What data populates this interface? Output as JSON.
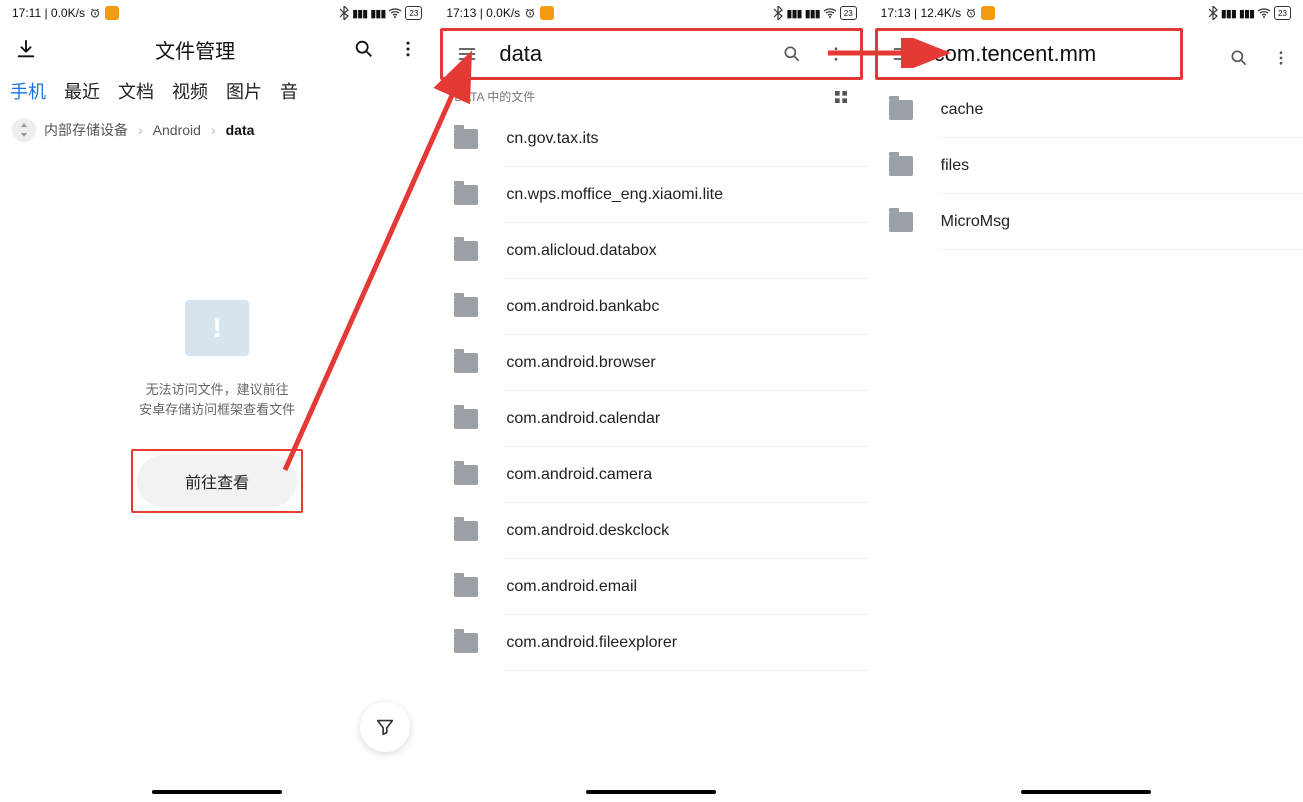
{
  "screen1": {
    "status": {
      "time_net": "17:11 | 0.0K/s",
      "battery_label": "23"
    },
    "top": {
      "title": "文件管理"
    },
    "tabs": [
      "手机",
      "最近",
      "文档",
      "视频",
      "图片",
      "音"
    ],
    "breadcrumb": {
      "a": "内部存储设备",
      "b": "Android",
      "c": "data"
    },
    "empty_line1": "无法访问文件，建议前往",
    "empty_line2": "安卓存储访问框架查看文件",
    "goto_label": "前往查看"
  },
  "screen2": {
    "status": {
      "time_net": "17:13 | 0.0K/s",
      "battery_label": "23"
    },
    "title": "data",
    "section_label": "DATA 中的文件",
    "folders": [
      "cn.gov.tax.its",
      "cn.wps.moffice_eng.xiaomi.lite",
      "com.alicloud.databox",
      "com.android.bankabc",
      "com.android.browser",
      "com.android.calendar",
      "com.android.camera",
      "com.android.deskclock",
      "com.android.email",
      "com.android.fileexplorer"
    ]
  },
  "screen3": {
    "status": {
      "time_net": "17:13 | 12.4K/s",
      "battery_label": "23"
    },
    "title": "com.tencent.mm",
    "folders": [
      "cache",
      "files",
      "MicroMsg"
    ]
  }
}
